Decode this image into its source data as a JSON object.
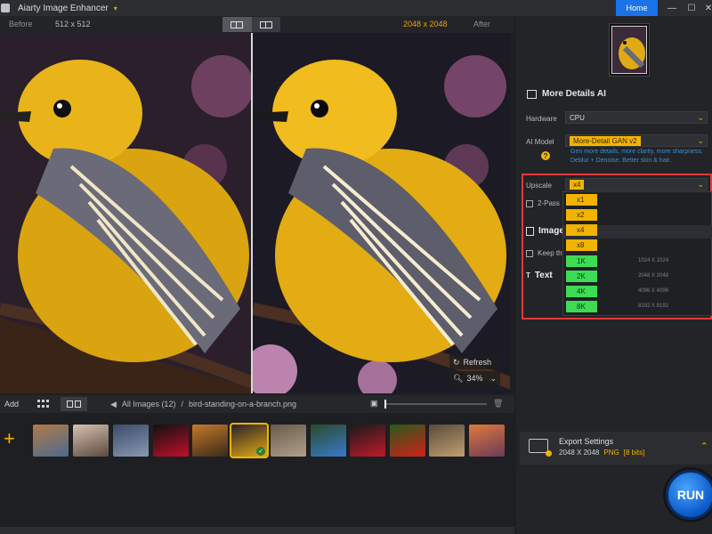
{
  "titlebar": {
    "app_title": "Aiarty Image Enhancer",
    "home_label": "Home",
    "minimize": "—",
    "maximize": "☐",
    "close": "✕"
  },
  "compare": {
    "before_label": "Before",
    "before_size": "512 x 512",
    "after_size": "2048 x 2048",
    "after_label": "After"
  },
  "image_overlay": {
    "refresh_label": "Refresh",
    "zoom_value": "34%"
  },
  "toolbar": {
    "add_label": "Add",
    "all_images": "All Images (12)",
    "separator": "/",
    "filename": "bird-standing-on-a-branch.png",
    "zoom_slider_fraction": 0.0
  },
  "thumbnails": [
    {
      "name": "cathedral"
    },
    {
      "name": "portrait"
    },
    {
      "name": "mountains"
    },
    {
      "name": "rose"
    },
    {
      "name": "tiger"
    },
    {
      "name": "bird-yellow",
      "selected": true
    },
    {
      "name": "moth"
    },
    {
      "name": "blue-bird"
    },
    {
      "name": "cherries"
    },
    {
      "name": "red-flower"
    },
    {
      "name": "woman-hair"
    },
    {
      "name": "sunset-city"
    }
  ],
  "panel": {
    "section_title": "More Details AI",
    "hardware_label": "Hardware",
    "hardware_value": "CPU",
    "ai_model_label": "AI Model",
    "ai_model_value": "More-Detail GAN v2",
    "ai_model_desc": "Gen more details, more clarity, more sharpness. Deblur + Denoise. Better skin & hair.",
    "upscale_label": "Upscale",
    "upscale_value": "x4",
    "two_pass_label": "2-Pass",
    "image_label": "Image",
    "keep_label": "Keep th",
    "text_label": "Text",
    "dropdown": [
      {
        "label": "x1",
        "kind": "multiplier",
        "res": ""
      },
      {
        "label": "x2",
        "kind": "multiplier",
        "res": ""
      },
      {
        "label": "x4",
        "kind": "multiplier",
        "res": ""
      },
      {
        "label": "x8",
        "kind": "multiplier",
        "res": ""
      },
      {
        "label": "1K",
        "kind": "resolution",
        "res": "1024 X 1024"
      },
      {
        "label": "2K",
        "kind": "resolution",
        "res": "2048 X 2048"
      },
      {
        "label": "4K",
        "kind": "resolution",
        "res": "4096 X 4096"
      },
      {
        "label": "8K",
        "kind": "resolution",
        "res": "8192 X 8192"
      }
    ],
    "export_title": "Export Settings",
    "export_size": "2048 X 2048",
    "export_format": "PNG",
    "export_bits": "[8 bits]",
    "run_label": "RUN"
  },
  "colors": {
    "accent": "#f2b400",
    "home_blue": "#1a73e8",
    "run_blue": "#0b57c6",
    "highlight_red": "#e03a3a",
    "green": "#3ddc55"
  }
}
